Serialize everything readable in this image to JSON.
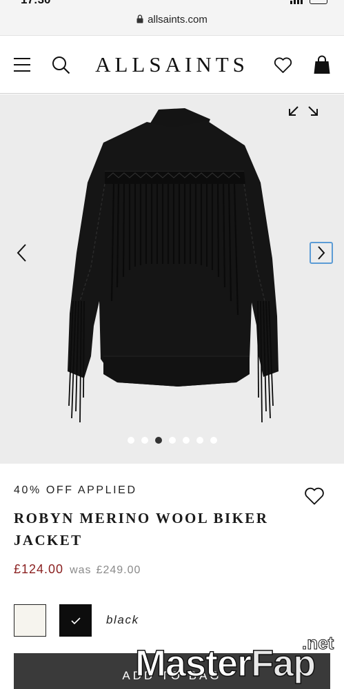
{
  "status_bar": {
    "time": "17:30"
  },
  "browser": {
    "url": "allsaints.com"
  },
  "header": {
    "brand": "ALLSAINTS"
  },
  "gallery": {
    "image_count": 7,
    "active_index": 2
  },
  "product": {
    "promo": "40% OFF APPLIED",
    "title_line1": "ROBYN MERINO WOOL BIKER",
    "title_line2": "JACKET",
    "price_now": "£124.00",
    "price_was_label": "was",
    "price_was": "£249.00",
    "colours": [
      {
        "name": "white"
      },
      {
        "name": "black",
        "selected": true
      }
    ],
    "selected_colour_label": "black"
  },
  "cta": {
    "add_label": "ADD TO BAG"
  },
  "watermark": {
    "part1": "Master",
    "part2": "Fap",
    "suffix": ".net"
  },
  "colors": {
    "price_sale": "#8a1f1f",
    "price_was": "#8a8a8a",
    "accent_focus": "#5b9bd5",
    "button_bg": "#3a3a3a"
  }
}
